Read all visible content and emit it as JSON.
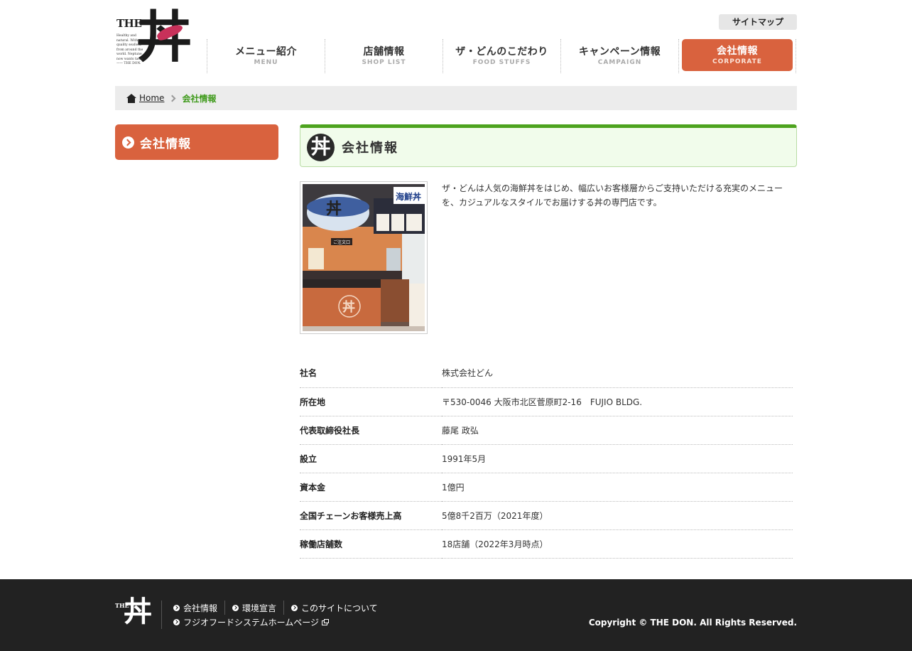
{
  "header": {
    "logo_the": "THE",
    "logo_kanji": "丼",
    "logo_tagline": "Healthy and natural. With quality seafood from around the world. Neptune now wants taste. —— THE DON.",
    "sitemap_label": "サイトマップ",
    "nav": [
      {
        "jp": "メニュー紹介",
        "en": "MENU"
      },
      {
        "jp": "店舗情報",
        "en": "SHOP LIST"
      },
      {
        "jp": "ザ・どんのこだわり",
        "en": "FOOD STUFFS"
      },
      {
        "jp": "キャンペーン情報",
        "en": "CAMPAIGN"
      },
      {
        "jp": "会社情報",
        "en": "CORPORATE"
      }
    ]
  },
  "breadcrumb": {
    "home": "Home",
    "current": "会社情報"
  },
  "sidebar": {
    "active_label": "会社情報"
  },
  "main": {
    "title": "会社情報",
    "head_icon_kanji": "丼",
    "intro": "ザ・どんは人気の海鮮丼をはじめ、幅広いお客様層からご支持いただける充実のメニューを、カジュアルなスタイルでお届けする丼の専門店です。",
    "photo_signs": {
      "menu_board": "海鮮丼",
      "counter": "ご注文口"
    },
    "info": [
      {
        "key": "社名",
        "value": "株式会社どん"
      },
      {
        "key": "所在地",
        "value": "〒530-0046 大阪市北区菅原町2-16　FUJIO BLDG."
      },
      {
        "key": "代表取締役社長",
        "value": "藤尾 政弘"
      },
      {
        "key": "設立",
        "value": "1991年5月"
      },
      {
        "key": "資本金",
        "value": "1億円"
      },
      {
        "key": "全国チェーンお客様売上高",
        "value": "5億8千2百万（2021年度）"
      },
      {
        "key": "稼働店舗数",
        "value": "18店舗（2022年3月時点）"
      }
    ]
  },
  "footer": {
    "logo_the": "THE",
    "logo_kanji": "丼",
    "links_row1": [
      "会社情報",
      "環境宣言",
      "このサイトについて"
    ],
    "links_row2": [
      "フジオフードシステムホームページ"
    ],
    "copyright": "Copyright © THE DON. All Rights Reserved."
  },
  "colors": {
    "accent_orange": "#d9623e",
    "accent_green": "#4da31e",
    "footer_bg": "#222222"
  }
}
